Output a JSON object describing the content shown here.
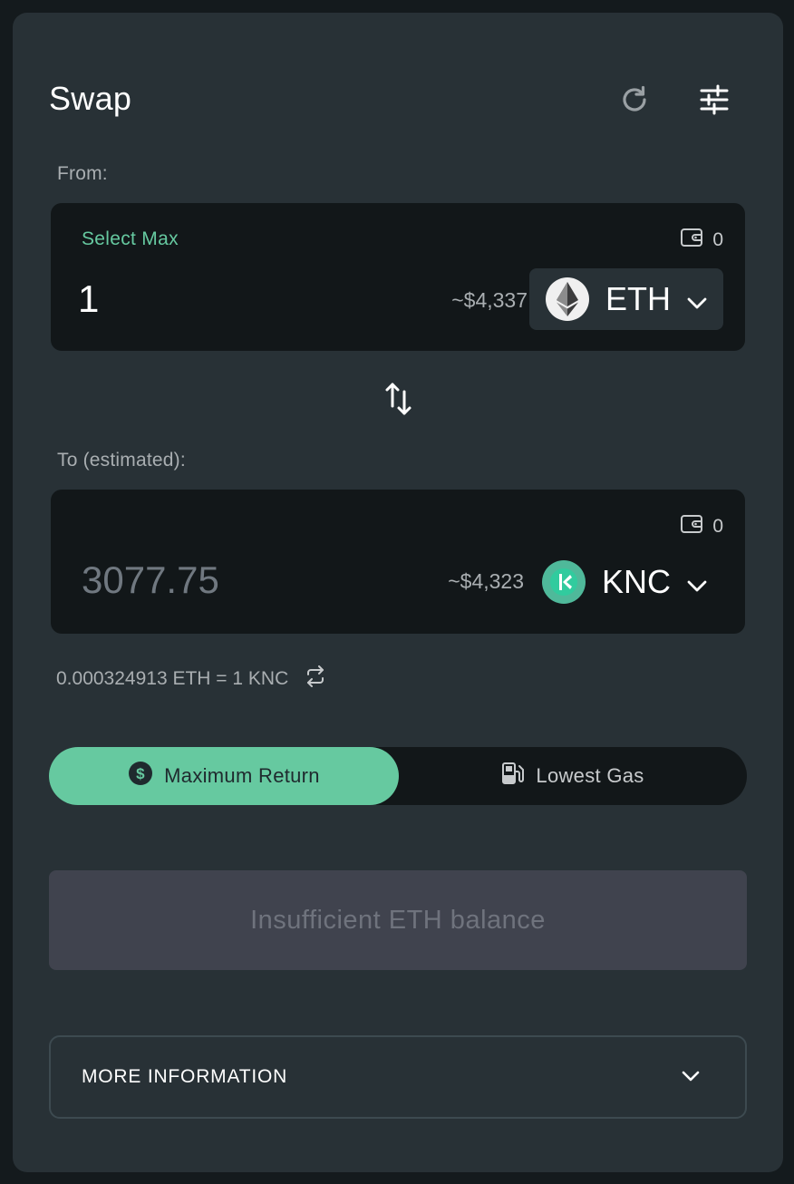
{
  "header": {
    "title": "Swap",
    "refresh_icon": "refresh-icon",
    "settings_icon": "sliders-icon"
  },
  "from": {
    "label": "From:",
    "select_max": "Select Max",
    "balance": "0",
    "amount": "1",
    "usd_value": "~$4,337",
    "token": "ETH"
  },
  "to": {
    "label": "To (estimated):",
    "balance": "0",
    "amount": "3077.75",
    "usd_value": "~$4,323",
    "token": "KNC"
  },
  "rate": {
    "text": "0.000324913 ETH = 1 KNC"
  },
  "route": {
    "max_return": "Maximum Return",
    "lowest_gas": "Lowest Gas",
    "selected": "Maximum Return"
  },
  "action": {
    "label": "Insufficient ETH balance"
  },
  "more_info": {
    "label": "MORE INFORMATION"
  },
  "colors": {
    "accent": "#66c9a0",
    "card": "#283136",
    "panel": "#121719",
    "disabled": "#40434e"
  }
}
